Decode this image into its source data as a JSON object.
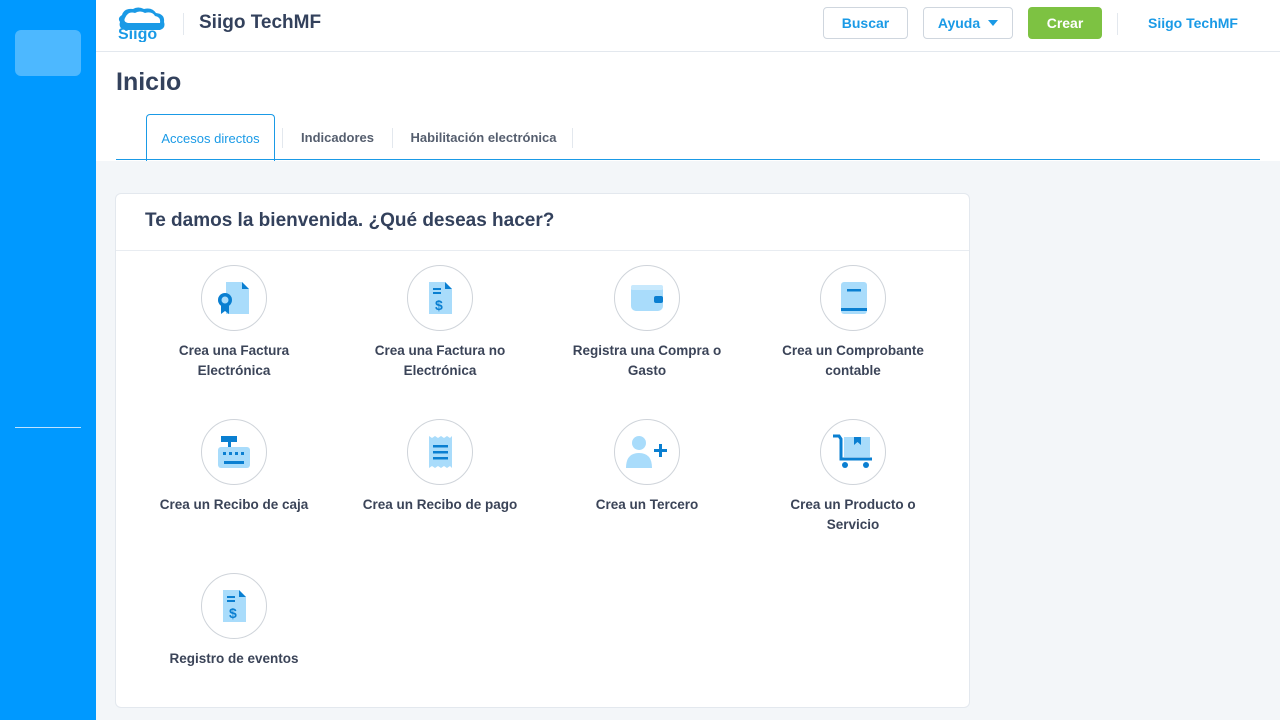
{
  "header": {
    "company": "Siigo TechMF",
    "buscar": "Buscar",
    "ayuda": "Ayuda",
    "crear": "Crear",
    "user": "Siigo TechMF"
  },
  "page": {
    "title": "Inicio",
    "tabs": [
      {
        "label": "Accesos directos"
      },
      {
        "label": "Indicadores"
      },
      {
        "label": "Habilitación electrónica"
      }
    ]
  },
  "card": {
    "title": "Te damos la bienvenida. ¿Qué deseas hacer?",
    "shortcuts": [
      {
        "label": "Crea una Factura Electrónica",
        "icon": "electronic-invoice-icon"
      },
      {
        "label": "Crea una Factura no Electrónica",
        "icon": "invoice-icon"
      },
      {
        "label": "Registra una Compra o Gasto",
        "icon": "wallet-icon"
      },
      {
        "label": "Crea un Comprobante contable",
        "icon": "accounting-book-icon"
      },
      {
        "label": "Crea un Recibo de caja",
        "icon": "cash-register-icon"
      },
      {
        "label": "Crea un Recibo de pago",
        "icon": "receipt-icon"
      },
      {
        "label": "Crea un Tercero",
        "icon": "add-user-icon"
      },
      {
        "label": "Crea un Producto o Servicio",
        "icon": "product-cart-icon"
      },
      {
        "label": "Registro de eventos",
        "icon": "event-log-icon"
      }
    ]
  },
  "colors": {
    "sidebar": "#0099ff",
    "accent": "#1a9ae6",
    "create_button": "#7dc242",
    "icon_light": "#a9dcfb",
    "icon_dark": "#0a7fd1"
  }
}
